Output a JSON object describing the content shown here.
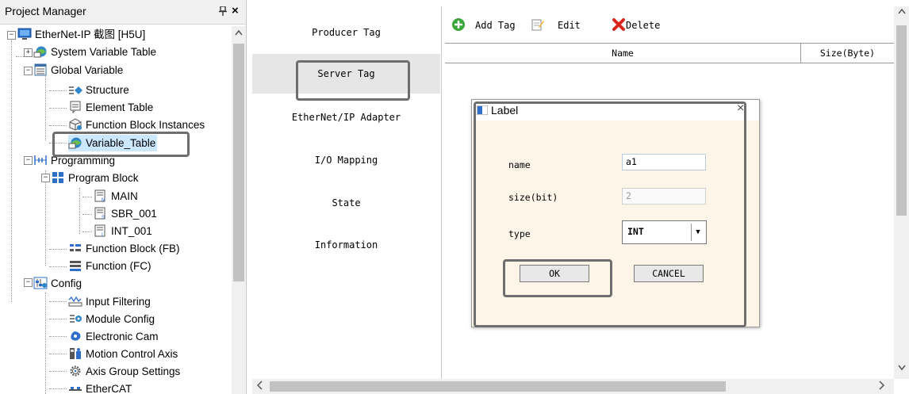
{
  "project_manager": {
    "title": "Project Manager",
    "pin_icon": "pin-icon",
    "close_label": "×",
    "items": [
      {
        "label": "EtherNet-IP 截图 [H5U]",
        "icon": "plc-device-icon"
      },
      {
        "label": "System Variable Table",
        "icon": "globe-table-icon"
      },
      {
        "label": "Global Variable",
        "icon": "table-icon"
      },
      {
        "label": "Structure",
        "icon": "structure-icon"
      },
      {
        "label": "Element Table",
        "icon": "element-table-icon"
      },
      {
        "label": "Function Block Instances",
        "icon": "fb-instance-icon"
      },
      {
        "label": "Variable_Table",
        "icon": "globe-table-icon"
      },
      {
        "label": "Programming",
        "icon": "ladder-icon"
      },
      {
        "label": "Program Block",
        "icon": "program-block-icon"
      },
      {
        "label": "MAIN",
        "icon": "main-program-icon"
      },
      {
        "label": "SBR_001",
        "icon": "subroutine-icon"
      },
      {
        "label": "INT_001",
        "icon": "interrupt-icon"
      },
      {
        "label": "Function Block (FB)",
        "icon": "function-block-icon"
      },
      {
        "label": "Function (FC)",
        "icon": "function-icon"
      },
      {
        "label": "Config",
        "icon": "config-icon"
      },
      {
        "label": "Input Filtering",
        "icon": "input-filter-icon"
      },
      {
        "label": "Module Config",
        "icon": "module-config-icon"
      },
      {
        "label": "Electronic Cam",
        "icon": "cam-icon"
      },
      {
        "label": "Motion Control Axis",
        "icon": "axis-icon"
      },
      {
        "label": "Axis Group Settings",
        "icon": "gear-icon"
      },
      {
        "label": "EtherCAT",
        "icon": "ethercat-icon"
      }
    ]
  },
  "nav": {
    "items": [
      "Producer Tag",
      "Server Tag",
      "EtherNet/IP Adapter",
      "I/O Mapping",
      "State",
      "Information"
    ],
    "active": "Server Tag"
  },
  "toolbar": {
    "add_label": "Add Tag",
    "edit_label": "Edit",
    "delete_label": "Delete"
  },
  "table": {
    "columns": [
      "Name",
      "Size(Byte)"
    ]
  },
  "dialog": {
    "title": "Label",
    "close_label": "×",
    "name_label": "name",
    "name_value": "a1",
    "size_label": "size(bit)",
    "size_value": "2",
    "type_label": "type",
    "type_value": "INT",
    "ok_label": "OK",
    "cancel_label": "CANCEL"
  },
  "colors": {
    "highlight_border": "#6e6e6e",
    "active_nav": "#e6e6e6",
    "dialog_bg": "#fdf6e8",
    "selected_tree_bg": "#cce8ff"
  }
}
